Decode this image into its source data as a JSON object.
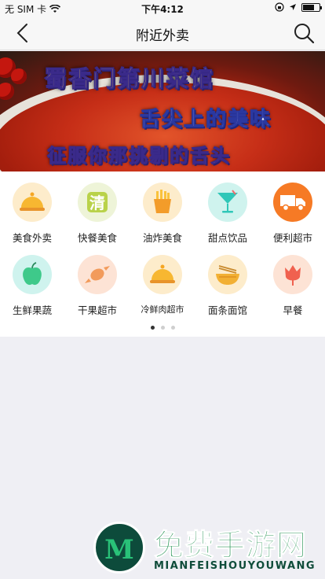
{
  "status_bar": {
    "carrier": "无 SIM 卡",
    "time": "下午4:12",
    "battery_level": 0.7
  },
  "nav": {
    "title": "附近外卖",
    "back_icon": "chevron-left-icon",
    "search_icon": "search-icon"
  },
  "banner": {
    "line1": "蜀香门第川菜馆",
    "line2": "舌尖上的美味",
    "line3": "征服你那挑剔的舌头"
  },
  "categories": [
    {
      "label": "美食外卖",
      "icon": "food-cloche-icon",
      "bg": "#fdeccb"
    },
    {
      "label": "快餐美食",
      "icon": "fast-food-icon",
      "bg": "#eef4d8"
    },
    {
      "label": "油炸美食",
      "icon": "fries-icon",
      "bg": "#fdeccb"
    },
    {
      "label": "甜点饮品",
      "icon": "cocktail-icon",
      "bg": "#cff3ee"
    },
    {
      "label": "便利超市",
      "icon": "truck-icon",
      "bg": "#f67a25"
    },
    {
      "label": "生鲜果蔬",
      "icon": "apple-icon",
      "bg": "#cff3ee"
    },
    {
      "label": "干果超市",
      "icon": "candy-icon",
      "bg": "#fde3d5"
    },
    {
      "label": "冷鲜肉超市",
      "icon": "meat-cloche-icon",
      "bg": "#fdeccb"
    },
    {
      "label": "面条面馆",
      "icon": "noodle-bowl-icon",
      "bg": "#fdeccb"
    },
    {
      "label": "早餐",
      "icon": "tulip-icon",
      "bg": "#fde3d5"
    }
  ],
  "pager": {
    "count": 3,
    "active": 0
  },
  "watermark": {
    "title": "免费手游网",
    "subtitle": "MIANFEISHOUYOUWANG",
    "logo_letter": "M"
  }
}
